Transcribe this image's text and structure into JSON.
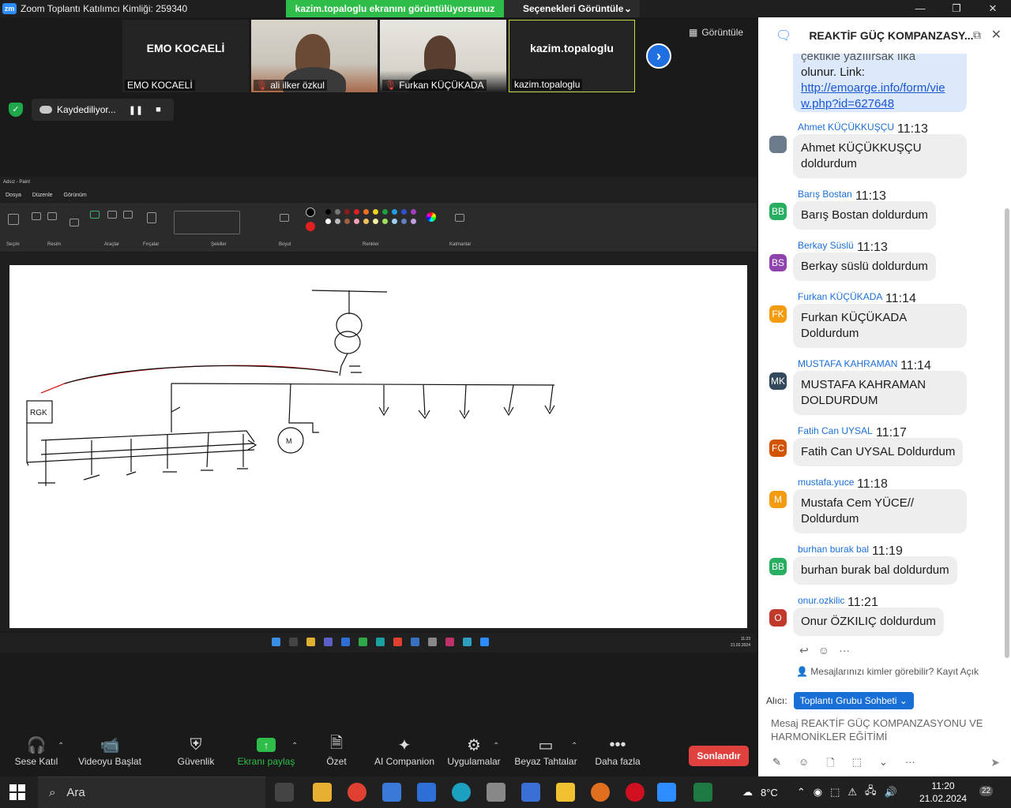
{
  "zoom": {
    "window_title": "Zoom Toplantı Katılımcı Kimliği: 259340",
    "logo": "zm",
    "share_banner": "kazim.topaloglu  ekranını görüntülüyorsunuz",
    "view_options": "Seçenekleri Görüntüle",
    "view_button": "Görüntüle",
    "recording_label": "Kaydediliyor...",
    "participants": [
      {
        "big_name": "EMO KOCAELİ",
        "label": "EMO KOCAELİ",
        "muted": false
      },
      {
        "big_name": "",
        "label": "ali ilker özkul",
        "muted": true
      },
      {
        "big_name": "",
        "label": "Furkan KÜÇÜKADA",
        "muted": true
      },
      {
        "big_name": "kazim.topaloglu",
        "label": "kazim.topaloglu",
        "muted": false
      }
    ]
  },
  "paint": {
    "window_title": "Adsız - Paint",
    "menu": [
      "Dosya",
      "Düzenle",
      "Görünüm"
    ],
    "groups": [
      "Seçim",
      "Resim",
      "Araçlar",
      "Fırçalar",
      "Şekiller",
      "Boyut",
      "Renkler",
      "Katmanlar"
    ],
    "inner_clock": {
      "time": "11:23",
      "date": "21.02.2024"
    }
  },
  "chat": {
    "title": "REAKTİF GÜÇ KOMPANZASY...",
    "first_bubble": {
      "text_top": "çektikle yazılırsak ılka",
      "text_2": "olunur. Link:",
      "link": "http://emoarge.info/form/view.php?id=627648",
      "link_line1": "http://emoarge.info/form/vie",
      "link_line2": "w.php?id=627648"
    },
    "messages": [
      {
        "name": "Ahmet KÜÇÜKKUŞÇU",
        "time": "11:13",
        "initials": "",
        "color": "#6b7b8c",
        "lines": [
          "Ahmet KÜÇÜKKUŞÇU",
          "doldurdum"
        ]
      },
      {
        "name": "Barış Bostan",
        "time": "11:13",
        "initials": "BB",
        "color": "#27ae60",
        "lines": [
          "Barış Bostan doldurdum"
        ]
      },
      {
        "name": "Berkay Süslü",
        "time": "11:13",
        "initials": "BS",
        "color": "#8e44ad",
        "lines": [
          "Berkay süslü doldurdum"
        ]
      },
      {
        "name": "Furkan KÜÇÜKADA",
        "time": "11:14",
        "initials": "FK",
        "color": "#f39c12",
        "lines": [
          "Furkan KÜÇÜKADA",
          "Doldurdum"
        ]
      },
      {
        "name": "MUSTAFA KAHRAMAN",
        "time": "11:14",
        "initials": "MK",
        "color": "#34495e",
        "lines": [
          "MUSTAFA KAHRAMAN",
          "DOLDURDUM"
        ]
      },
      {
        "name": "Fatih Can UYSAL",
        "time": "11:17",
        "initials": "FC",
        "color": "#d35400",
        "lines": [
          "Fatih Can UYSAL Doldurdum"
        ]
      },
      {
        "name": "mustafa.yuce",
        "time": "11:18",
        "initials": "M",
        "color": "#f39c12",
        "lines": [
          "Mustafa Cem YÜCE//",
          "Doldurdum"
        ]
      },
      {
        "name": "burhan burak bal",
        "time": "11:19",
        "initials": "BB",
        "color": "#27ae60",
        "lines": [
          "burhan burak bal doldurdum"
        ]
      },
      {
        "name": "onur.ozkilic",
        "time": "11:21",
        "initials": "O",
        "color": "#c0392b",
        "lines": [
          "Onur ÖZKILIÇ doldurdum"
        ]
      }
    ],
    "who_can_see": "Mesajlarınızı kimler görebilir? Kayıt Açık",
    "recipient_label": "Alıcı:",
    "recipient_value": "Toplantı Grubu Sohbeti",
    "input_placeholder_1": "Mesaj REAKTİF GÜÇ KOMPANZASYONU VE",
    "input_placeholder_2": "HARMONİKLER EĞİTİMİ"
  },
  "toolbar": {
    "items": [
      {
        "label": "Sese Katıl",
        "icon": "headphones-icon"
      },
      {
        "label": "Videoyu Başlat",
        "icon": "video-off-icon"
      },
      {
        "label": "Güvenlik",
        "icon": "shield-icon"
      },
      {
        "label": "Ekranı paylaş",
        "icon": "share-screen-icon"
      },
      {
        "label": "Özet",
        "icon": "summary-icon"
      },
      {
        "label": "AI Companion",
        "icon": "sparkle-icon"
      },
      {
        "label": "Uygulamalar",
        "icon": "apps-icon"
      },
      {
        "label": "Beyaz Tahtalar",
        "icon": "whiteboard-icon"
      },
      {
        "label": "Daha fazla",
        "icon": "more-icon"
      }
    ],
    "end_label": "Sonlandır"
  },
  "taskbar": {
    "search_placeholder": "Ara",
    "temperature": "8°C",
    "time": "11:20",
    "date": "21.02.2024",
    "notifications": "22"
  }
}
